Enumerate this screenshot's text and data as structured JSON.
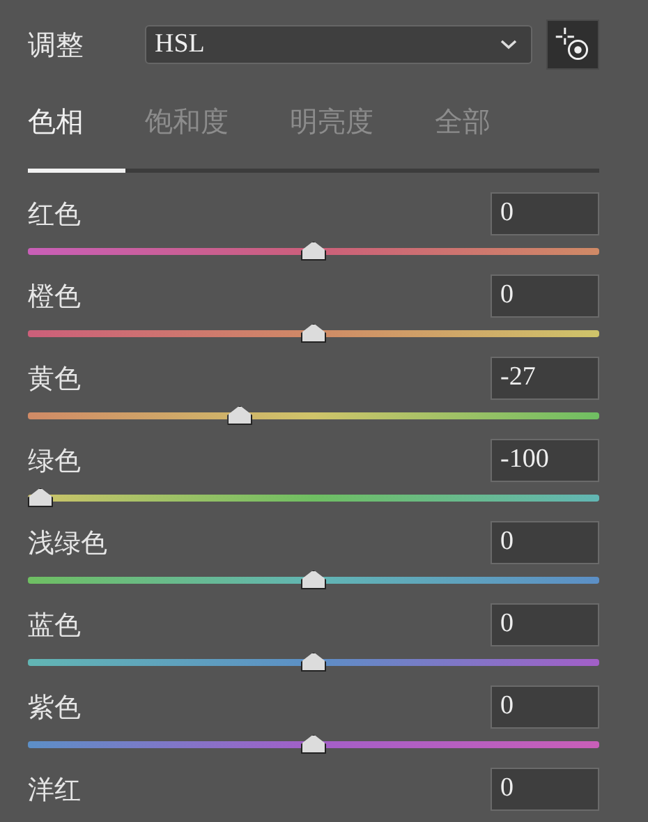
{
  "header": {
    "label": "调整",
    "dropdown": {
      "value": "HSL"
    }
  },
  "tabs": [
    {
      "label": "色相",
      "selected": true
    },
    {
      "label": "饱和度",
      "selected": false
    },
    {
      "label": "明亮度",
      "selected": false
    },
    {
      "label": "全部",
      "selected": false
    }
  ],
  "channels": [
    {
      "name": "红色",
      "value": "0",
      "level": 0.5,
      "color": "#cc5f7a"
    },
    {
      "name": "橙色",
      "value": "0",
      "level": 0.5,
      "color": "#d08a66"
    },
    {
      "name": "黄色",
      "value": "-27",
      "level": 0.365,
      "color": "#cfc46a"
    },
    {
      "name": "绿色",
      "value": "-100",
      "level": 0,
      "color": "#6fbf62"
    },
    {
      "name": "浅绿色",
      "value": "0",
      "level": 0.5,
      "color": "#62b6b4"
    },
    {
      "name": "蓝色",
      "value": "0",
      "level": 0.5,
      "color": "#5c8fc6"
    },
    {
      "name": "紫色",
      "value": "0",
      "level": 0.5,
      "color": "#a35fc8"
    },
    {
      "name": "洋红",
      "value": "0",
      "color": "#c95fb8"
    }
  ]
}
